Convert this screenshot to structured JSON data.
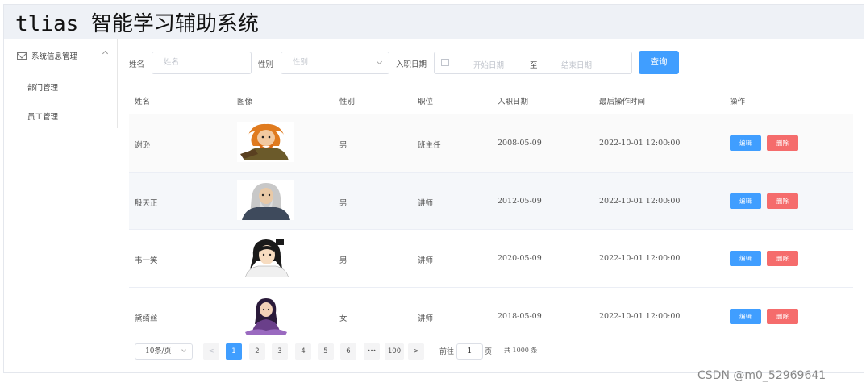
{
  "app": {
    "title": "tlias 智能学习辅助系统"
  },
  "sidebar": {
    "menu_title": "系统信息管理",
    "items": [
      {
        "label": "部门管理"
      },
      {
        "label": "员工管理"
      }
    ]
  },
  "search": {
    "name_label": "姓名",
    "name_placeholder": "姓名",
    "gender_label": "性别",
    "gender_placeholder": "性别",
    "date_label": "入职日期",
    "start_placeholder": "开始日期",
    "separator": "至",
    "end_placeholder": "结束日期",
    "query_button": "查询"
  },
  "table": {
    "headers": [
      "姓名",
      "图像",
      "性别",
      "职位",
      "入职日期",
      "最后操作时间",
      "操作"
    ],
    "rows": [
      {
        "name": "谢逊",
        "avatar": "warrior-portrait",
        "gender": "男",
        "position": "班主任",
        "entry_date": "2008-05-09",
        "updated": "2022-10-01 12:00:00"
      },
      {
        "name": "殷天正",
        "avatar": "elder-portrait",
        "gender": "男",
        "position": "讲师",
        "entry_date": "2012-05-09",
        "updated": "2022-10-01 12:00:00"
      },
      {
        "name": "韦一笑",
        "avatar": "swordsman-portrait",
        "gender": "男",
        "position": "讲师",
        "entry_date": "2020-05-09",
        "updated": "2022-10-01 12:00:00"
      },
      {
        "name": "黛绮丝",
        "avatar": "lady-portrait",
        "gender": "女",
        "position": "讲师",
        "entry_date": "2018-05-09",
        "updated": "2022-10-01 12:00:00"
      }
    ],
    "edit_label": "编辑",
    "delete_label": "删除"
  },
  "pagination": {
    "page_size": "10条/页",
    "prev": "<",
    "pages": [
      "1",
      "2",
      "3",
      "4",
      "5",
      "6",
      "•••",
      "100"
    ],
    "next": ">",
    "current": "1",
    "goto_prefix": "前往",
    "goto_value": "1",
    "goto_suffix": "页",
    "total": "共 1000 条"
  },
  "watermark": "CSDN @m0_52969641",
  "colors": {
    "primary": "#409eff",
    "danger": "#f56c6c",
    "header_bg": "#eef1f6"
  }
}
